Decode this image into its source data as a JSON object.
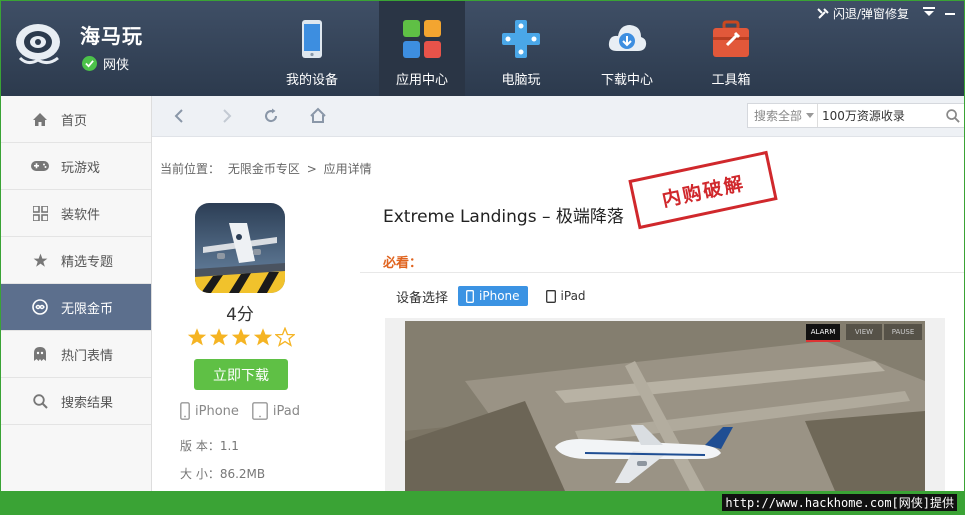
{
  "header": {
    "brand": "海马玩",
    "sub_label": "网侠",
    "nav": [
      {
        "label": "我的设备",
        "icon": "phone-icon"
      },
      {
        "label": "应用中心",
        "icon": "app-grid-icon"
      },
      {
        "label": "电脑玩",
        "icon": "gamepad-icon"
      },
      {
        "label": "下载中心",
        "icon": "cloud-download-icon"
      },
      {
        "label": "工具箱",
        "icon": "toolbox-icon"
      }
    ],
    "repair_label": "闪退/弹窗修复"
  },
  "sidebar": {
    "items": [
      {
        "label": "首页",
        "icon": "home-icon"
      },
      {
        "label": "玩游戏",
        "icon": "gamepad-icon"
      },
      {
        "label": "装软件",
        "icon": "grid-icon"
      },
      {
        "label": "精选专题",
        "icon": "star-icon"
      },
      {
        "label": "无限金币",
        "icon": "coin-icon"
      },
      {
        "label": "热门表情",
        "icon": "ghost-icon"
      },
      {
        "label": "搜索结果",
        "icon": "search-icon"
      }
    ],
    "active_index": 4
  },
  "toolbar": {
    "search_scope": "搜索全部",
    "search_value": "100万资源收录"
  },
  "breadcrumb": {
    "prefix": "当前位置：",
    "section": "无限金币专区",
    "separator": ">",
    "current": "应用详情"
  },
  "app": {
    "title": "Extreme Landings – 极端降落",
    "score": "4分",
    "rating": 4,
    "rating_max": 5,
    "download_label": "立即下载",
    "device_iphone": "iPhone",
    "device_ipad": "iPad",
    "version": "版 本：1.1",
    "size": "大 小：86.2MB",
    "stamp": "内购破解",
    "must_see": "必看：",
    "device_select_label": "设备选择",
    "device_options": [
      "iPhone",
      "iPad"
    ],
    "selected_device": "iPhone",
    "screenshot_controls": [
      "ALARM",
      "VIEW",
      "PAUSE"
    ]
  },
  "watermark": "http://www.hackhome.com[网侠]提供",
  "colors": {
    "header_bg": "#34445a",
    "sidebar_active": "#5c6f8d",
    "download_green": "#5fc045",
    "stamp_red": "#d0282c",
    "must_see_orange": "#e0641f",
    "device_active_blue": "#3b93e3",
    "bottom_green": "#3aa335"
  }
}
